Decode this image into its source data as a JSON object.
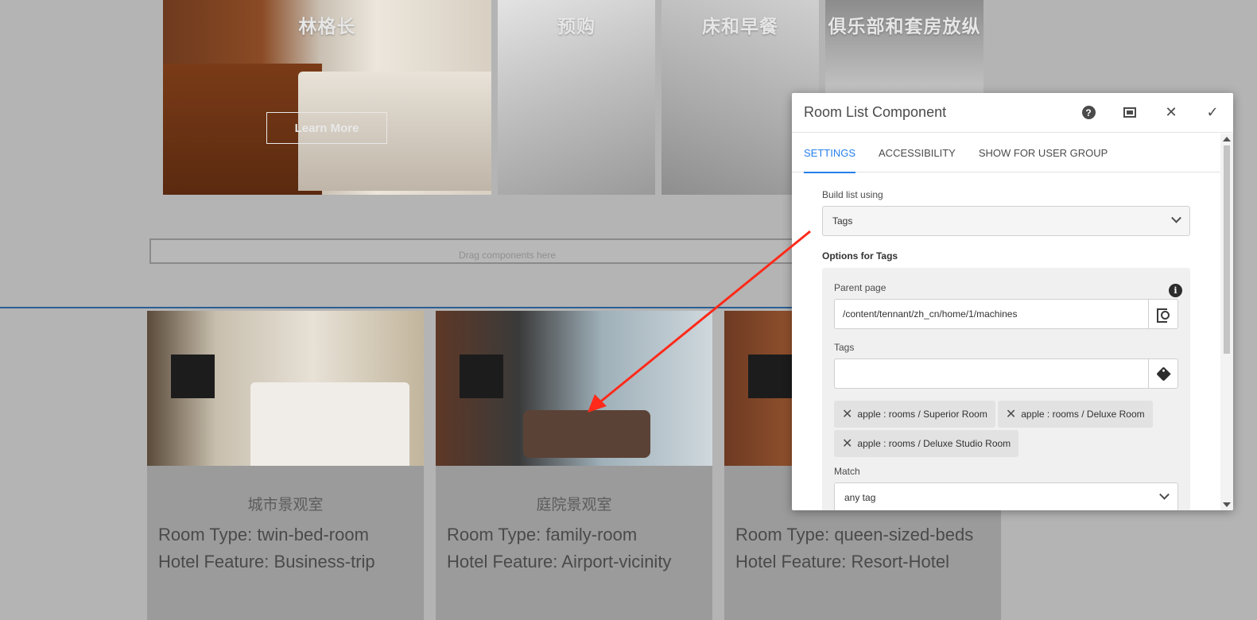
{
  "promos": [
    {
      "title": "林格长",
      "button": "Learn More"
    },
    {
      "title": "预购"
    },
    {
      "title": "床和早餐"
    },
    {
      "title": "俱乐部和套房放纵"
    }
  ],
  "drop_zone": "Drag components here",
  "rooms": [
    {
      "name": "城市景观室",
      "type": "Room Type: twin-bed-room",
      "feature": "Hotel Feature: Business-trip"
    },
    {
      "name": "庭院景观室",
      "type": "Room Type: family-room",
      "feature": "Hotel Feature: Airport-vicinity"
    },
    {
      "name": "",
      "type": "Room Type: queen-sized-beds",
      "feature": "Hotel Feature: Resort-Hotel"
    }
  ],
  "dialog": {
    "title": "Room List Component",
    "tabs": [
      "SETTINGS",
      "ACCESSIBILITY",
      "SHOW FOR USER GROUP"
    ],
    "build_list_label": "Build list using",
    "build_list_value": "Tags",
    "options_heading": "Options for Tags",
    "parent_page_label": "Parent page",
    "parent_page_value": "/content/tennant/zh_cn/home/1/machines",
    "tags_label": "Tags",
    "tags_value": "",
    "selected_tags": [
      "apple : rooms / Superior Room",
      "apple : rooms / Deluxe Room",
      "apple : rooms / Deluxe Studio Room"
    ],
    "match_label": "Match",
    "match_value": "any tag"
  },
  "colors": {
    "accent": "#2680eb",
    "annotation_arrow": "#ff2a1a",
    "separator": "#2b5f93"
  }
}
